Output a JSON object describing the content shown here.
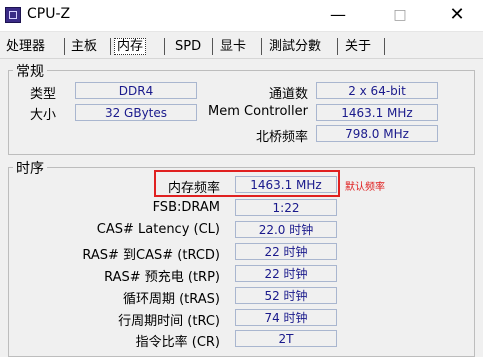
{
  "window": {
    "title": "CPU-Z",
    "minimize": "—",
    "maximize": "□",
    "close": "✕"
  },
  "tabs": [
    {
      "label": "处理器"
    },
    {
      "label": "主板"
    },
    {
      "label": "内存",
      "active": true
    },
    {
      "label": "SPD"
    },
    {
      "label": "显卡"
    },
    {
      "label": "測試分數"
    },
    {
      "label": "关于"
    }
  ],
  "general": {
    "title": "常规",
    "type_label": "类型",
    "type_value": "DDR4",
    "size_label": "大小",
    "size_value": "32 GBytes",
    "channel_label": "通道数",
    "channel_value": "2 x 64-bit",
    "memctrl_label": "Mem Controller",
    "memctrl_value": "1463.1 MHz",
    "nb_label": "北桥频率",
    "nb_value": "798.0 MHz"
  },
  "timings": {
    "title": "时序",
    "freq_label": "内存频率",
    "freq_value": "1463.1 MHz",
    "fsb_label": "FSB:DRAM",
    "fsb_value": "1:22",
    "cl_label": "CAS# Latency (CL)",
    "cl_value": "22.0 时钟",
    "trcd_label": "RAS# 到CAS# (tRCD)",
    "trcd_value": "22 时钟",
    "trp_label": "RAS# 预充电 (tRP)",
    "trp_value": "22 时钟",
    "tras_label": "循环周期 (tRAS)",
    "tras_value": "52 时钟",
    "trc_label": "行周期时间 (tRC)",
    "trc_value": "74 时钟",
    "cr_label": "指令比率 (CR)",
    "cr_value": "2T"
  },
  "annotation": "默认频率",
  "colors": {
    "highlight": "#e02020",
    "value_text": "#1a1a8c"
  }
}
